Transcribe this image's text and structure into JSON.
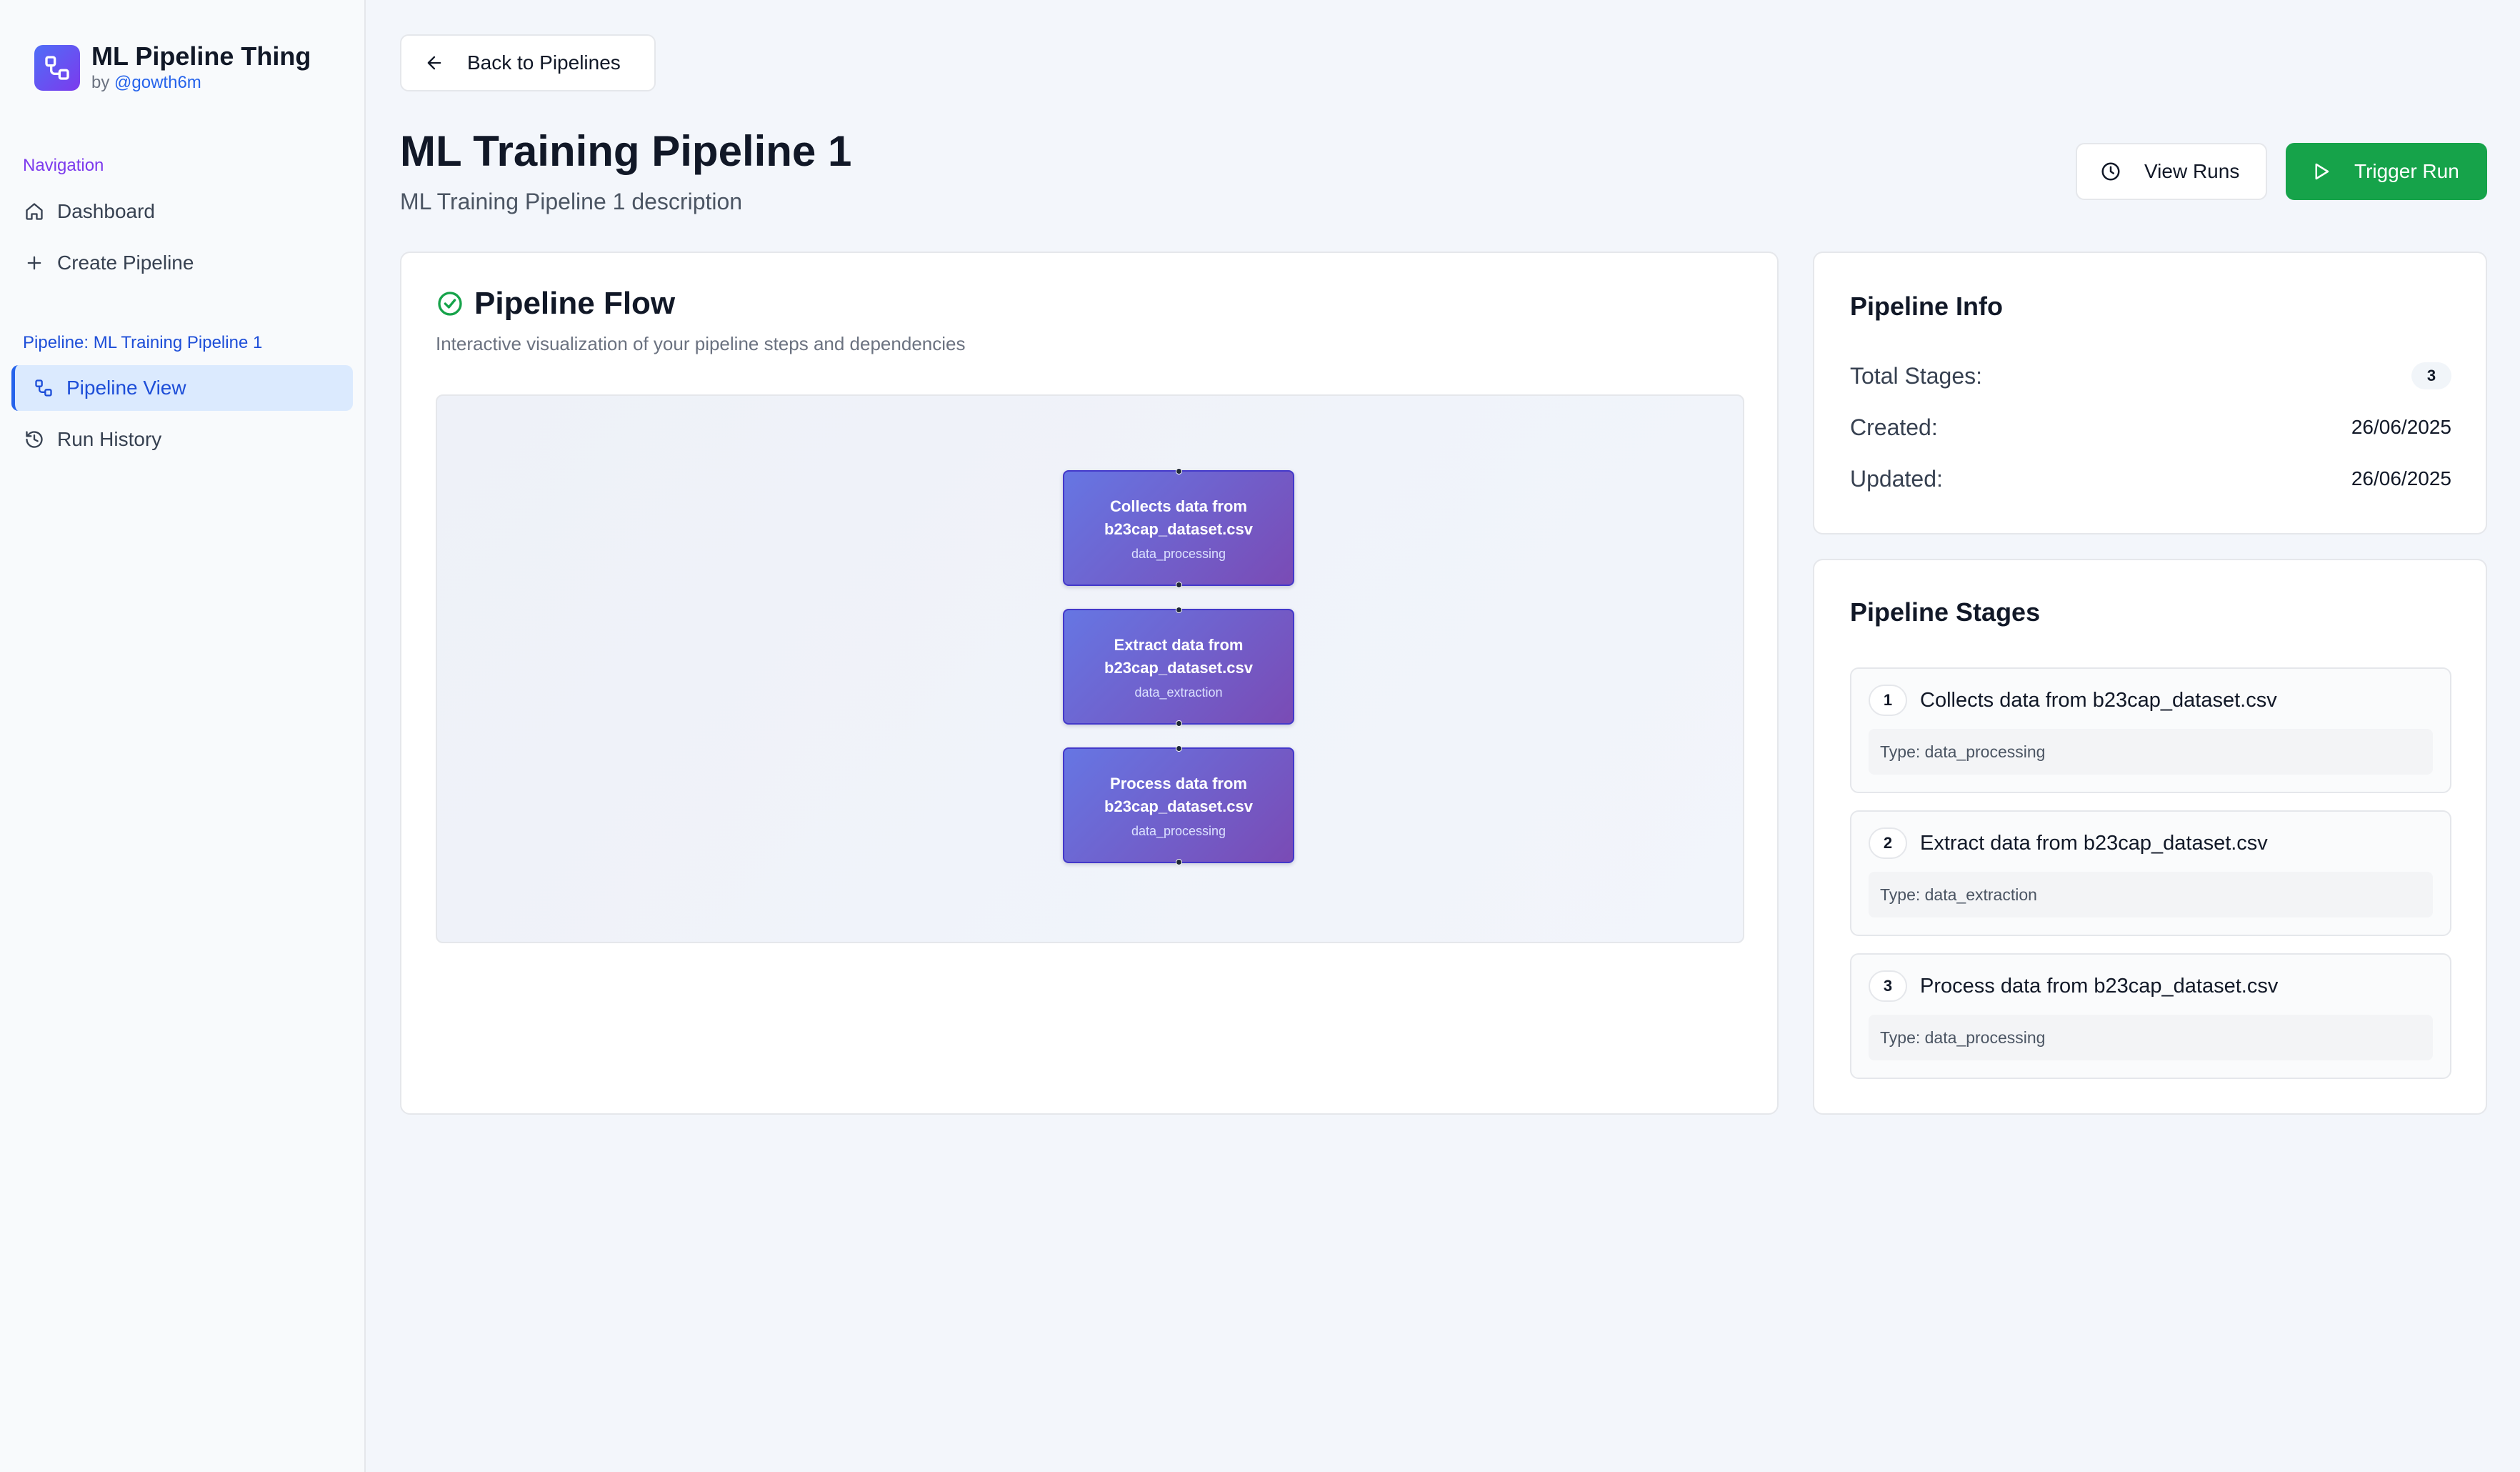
{
  "app": {
    "title": "ML Pipeline Thing",
    "by_prefix": "by",
    "by_handle": "@gowth6m"
  },
  "sidebar": {
    "navigation_label": "Navigation",
    "nav_items": [
      {
        "label": "Dashboard",
        "icon": "home-icon"
      },
      {
        "label": "Create Pipeline",
        "icon": "plus-icon"
      }
    ],
    "pipeline_label": "Pipeline: ML Training Pipeline 1",
    "pipeline_items": [
      {
        "label": "Pipeline View",
        "icon": "workflow-icon",
        "active": true
      },
      {
        "label": "Run History",
        "icon": "history-icon",
        "active": false
      }
    ]
  },
  "header": {
    "back_label": "Back to Pipelines",
    "title": "ML Training Pipeline 1",
    "description": "ML Training Pipeline 1 description",
    "view_runs_label": "View Runs",
    "trigger_run_label": "Trigger Run"
  },
  "flow": {
    "title": "Pipeline Flow",
    "subtitle": "Interactive visualization of your pipeline steps and dependencies",
    "nodes": [
      {
        "label": "Collects data from b23cap_dataset.csv",
        "type": "data_processing"
      },
      {
        "label": "Extract data from b23cap_dataset.csv",
        "type": "data_extraction"
      },
      {
        "label": "Process data from b23cap_dataset.csv",
        "type": "data_processing"
      }
    ]
  },
  "info": {
    "title": "Pipeline Info",
    "total_stages_label": "Total Stages:",
    "total_stages": "3",
    "created_label": "Created:",
    "created": "26/06/2025",
    "updated_label": "Updated:",
    "updated": "26/06/2025"
  },
  "stages": {
    "title": "Pipeline Stages",
    "items": [
      {
        "num": "1",
        "name": "Collects data from b23cap_dataset.csv",
        "type": "Type: data_processing"
      },
      {
        "num": "2",
        "name": "Extract data from b23cap_dataset.csv",
        "type": "Type: data_extraction"
      },
      {
        "num": "3",
        "name": "Process data from b23cap_dataset.csv",
        "type": "Type: data_processing"
      }
    ]
  },
  "colors": {
    "accent_green": "#16a34a",
    "accent_blue": "#2563eb",
    "nav_purple": "#7c3aed",
    "node_gradient_start": "#6676e3",
    "node_gradient_end": "#7a4bb5"
  }
}
